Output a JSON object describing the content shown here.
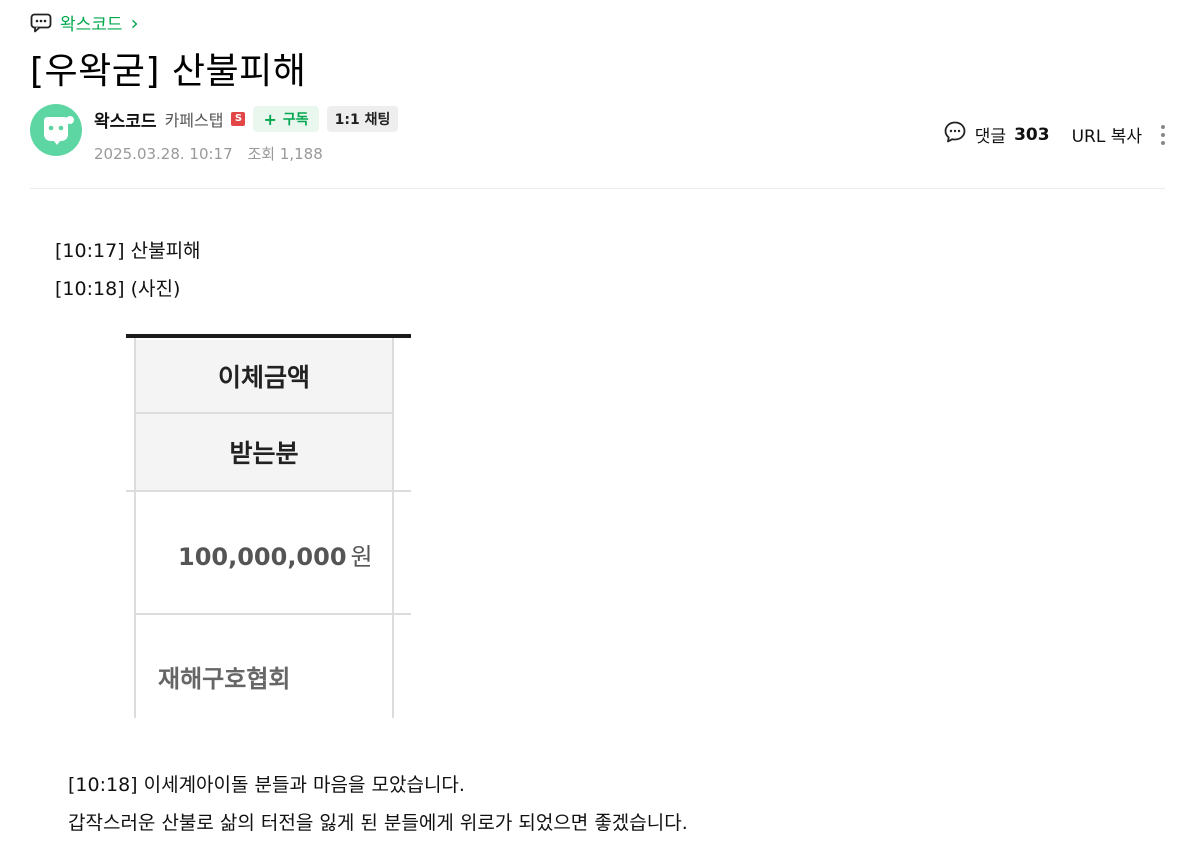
{
  "cafe": {
    "name": "왁스코드",
    "chevron": "›"
  },
  "post": {
    "title": "[우왁굳] 산불피해",
    "author": "왁스코드",
    "level": "카페스탭",
    "level_badge": "S",
    "subscribe_label": "구독",
    "subscribe_plus": "+",
    "chat_label": "1:1 채팅",
    "date": "2025.03.28. 10:17",
    "views": "조회 1,188"
  },
  "tools": {
    "comment_label": "댓글",
    "comment_count": "303",
    "url_copy_label": "URL 복사"
  },
  "content": {
    "lines_top": [
      "[10:17] 산불피해",
      "[10:18] (사진)"
    ],
    "image": {
      "header_1": "이체금액",
      "header_2": "받는분",
      "amount": "100,000,000",
      "currency": "원",
      "receiver": "재해구호협회"
    },
    "lines_bottom": [
      "[10:18] 이세계아이돌 분들과 마음을 모았습니다.",
      "갑작스러운 산불로 삶의 터전을 잃게 된 분들에게 위로가 되었으면 좋겠습니다."
    ]
  },
  "colors": {
    "brand_green": "#03a84e",
    "avatar_bg": "#5ed6a4",
    "badge_red": "#e24646"
  }
}
